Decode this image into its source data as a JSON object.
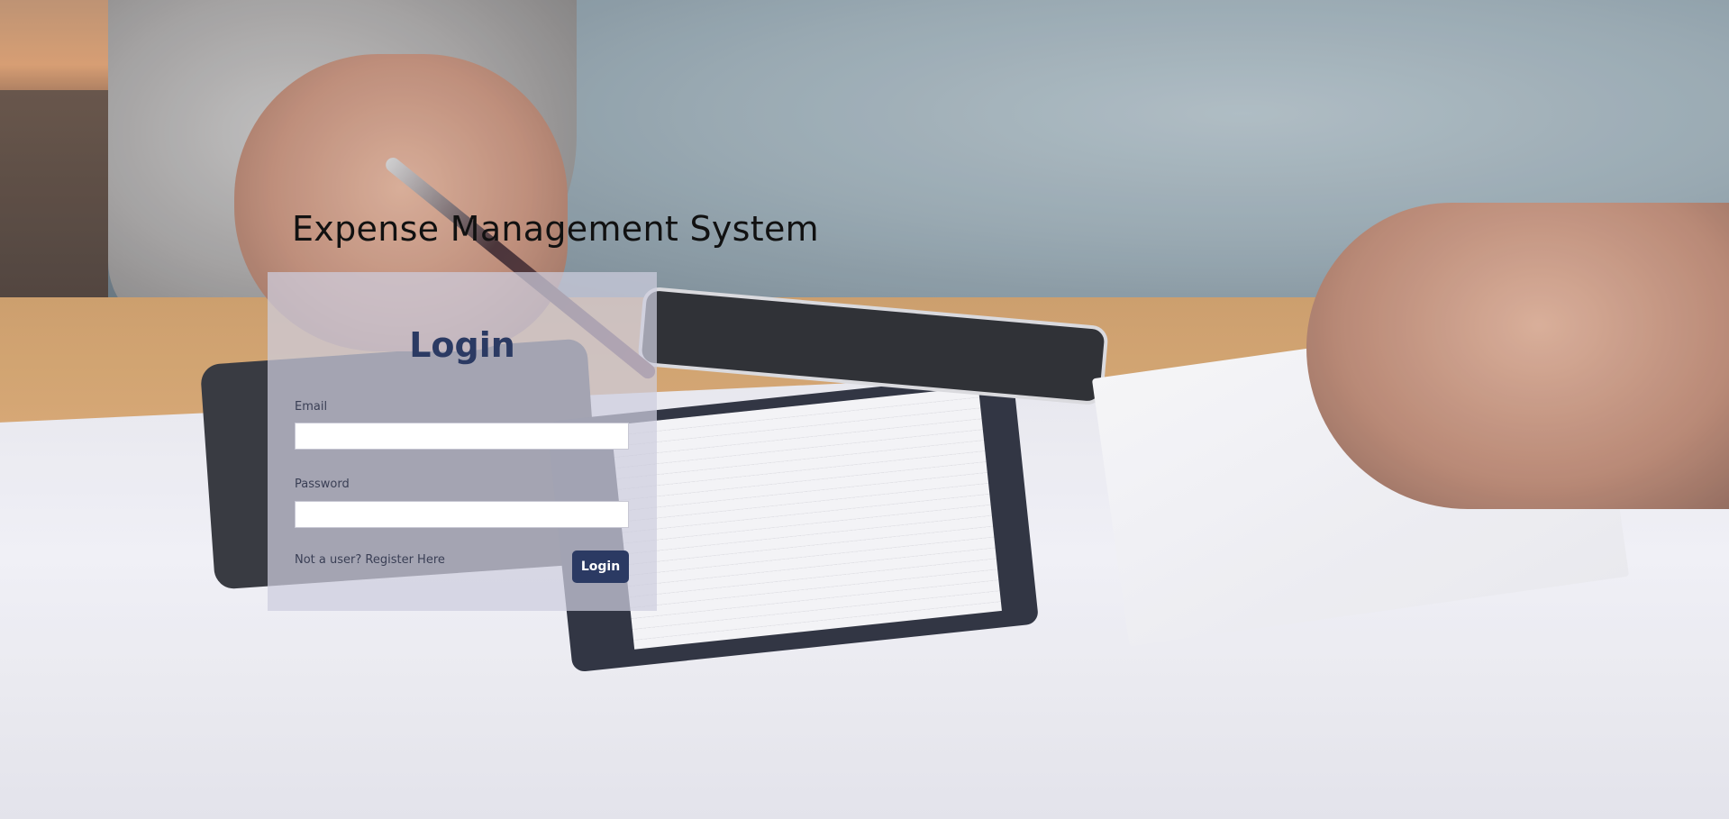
{
  "app": {
    "title": "Expense Management System"
  },
  "login": {
    "heading": "Login",
    "email_label": "Email",
    "email_value": "",
    "password_label": "Password",
    "password_value": "",
    "register_text": "Not a user? Register Here",
    "submit_label": "Login"
  },
  "colors": {
    "primary": "#2b3a63",
    "panel_background": "#cdcdde",
    "title_text": "#111111"
  }
}
